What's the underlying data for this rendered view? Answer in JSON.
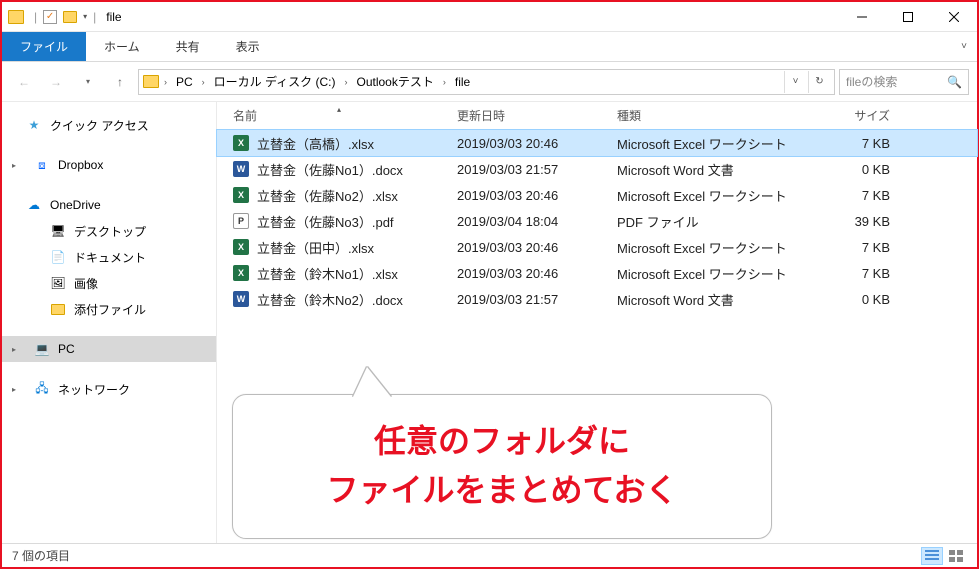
{
  "title": "file",
  "ribbon": {
    "file": "ファイル",
    "home": "ホーム",
    "share": "共有",
    "view": "表示"
  },
  "breadcrumbs": [
    "PC",
    "ローカル ディスク (C:)",
    "Outlookテスト",
    "file"
  ],
  "search_placeholder": "fileの検索",
  "columns": {
    "name": "名前",
    "date": "更新日時",
    "type": "種類",
    "size": "サイズ"
  },
  "nav": {
    "quick": "クイック アクセス",
    "dropbox": "Dropbox",
    "onedrive": "OneDrive",
    "desktop": "デスクトップ",
    "documents": "ドキュメント",
    "pictures": "画像",
    "attachments": "添付ファイル",
    "pc": "PC",
    "network": "ネットワーク"
  },
  "files": [
    {
      "name": "立替金（高橋）.xlsx",
      "date": "2019/03/03 20:46",
      "type": "Microsoft Excel ワークシート",
      "size": "7 KB",
      "ico": "xlsx",
      "sel": true
    },
    {
      "name": "立替金（佐藤No1）.docx",
      "date": "2019/03/03 21:57",
      "type": "Microsoft Word 文書",
      "size": "0 KB",
      "ico": "docx"
    },
    {
      "name": "立替金（佐藤No2）.xlsx",
      "date": "2019/03/03 20:46",
      "type": "Microsoft Excel ワークシート",
      "size": "7 KB",
      "ico": "xlsx"
    },
    {
      "name": "立替金（佐藤No3）.pdf",
      "date": "2019/03/04 18:04",
      "type": "PDF ファイル",
      "size": "39 KB",
      "ico": "pdf"
    },
    {
      "name": "立替金（田中）.xlsx",
      "date": "2019/03/03 20:46",
      "type": "Microsoft Excel ワークシート",
      "size": "7 KB",
      "ico": "xlsx"
    },
    {
      "name": "立替金（鈴木No1）.xlsx",
      "date": "2019/03/03 20:46",
      "type": "Microsoft Excel ワークシート",
      "size": "7 KB",
      "ico": "xlsx"
    },
    {
      "name": "立替金（鈴木No2）.docx",
      "date": "2019/03/03 21:57",
      "type": "Microsoft Word 文書",
      "size": "0 KB",
      "ico": "docx"
    }
  ],
  "status": "7 個の項目",
  "callout": {
    "line1": "任意のフォルダに",
    "line2": "ファイルをまとめておく"
  },
  "icon_label": {
    "xlsx": "X",
    "docx": "W",
    "pdf": "P"
  }
}
